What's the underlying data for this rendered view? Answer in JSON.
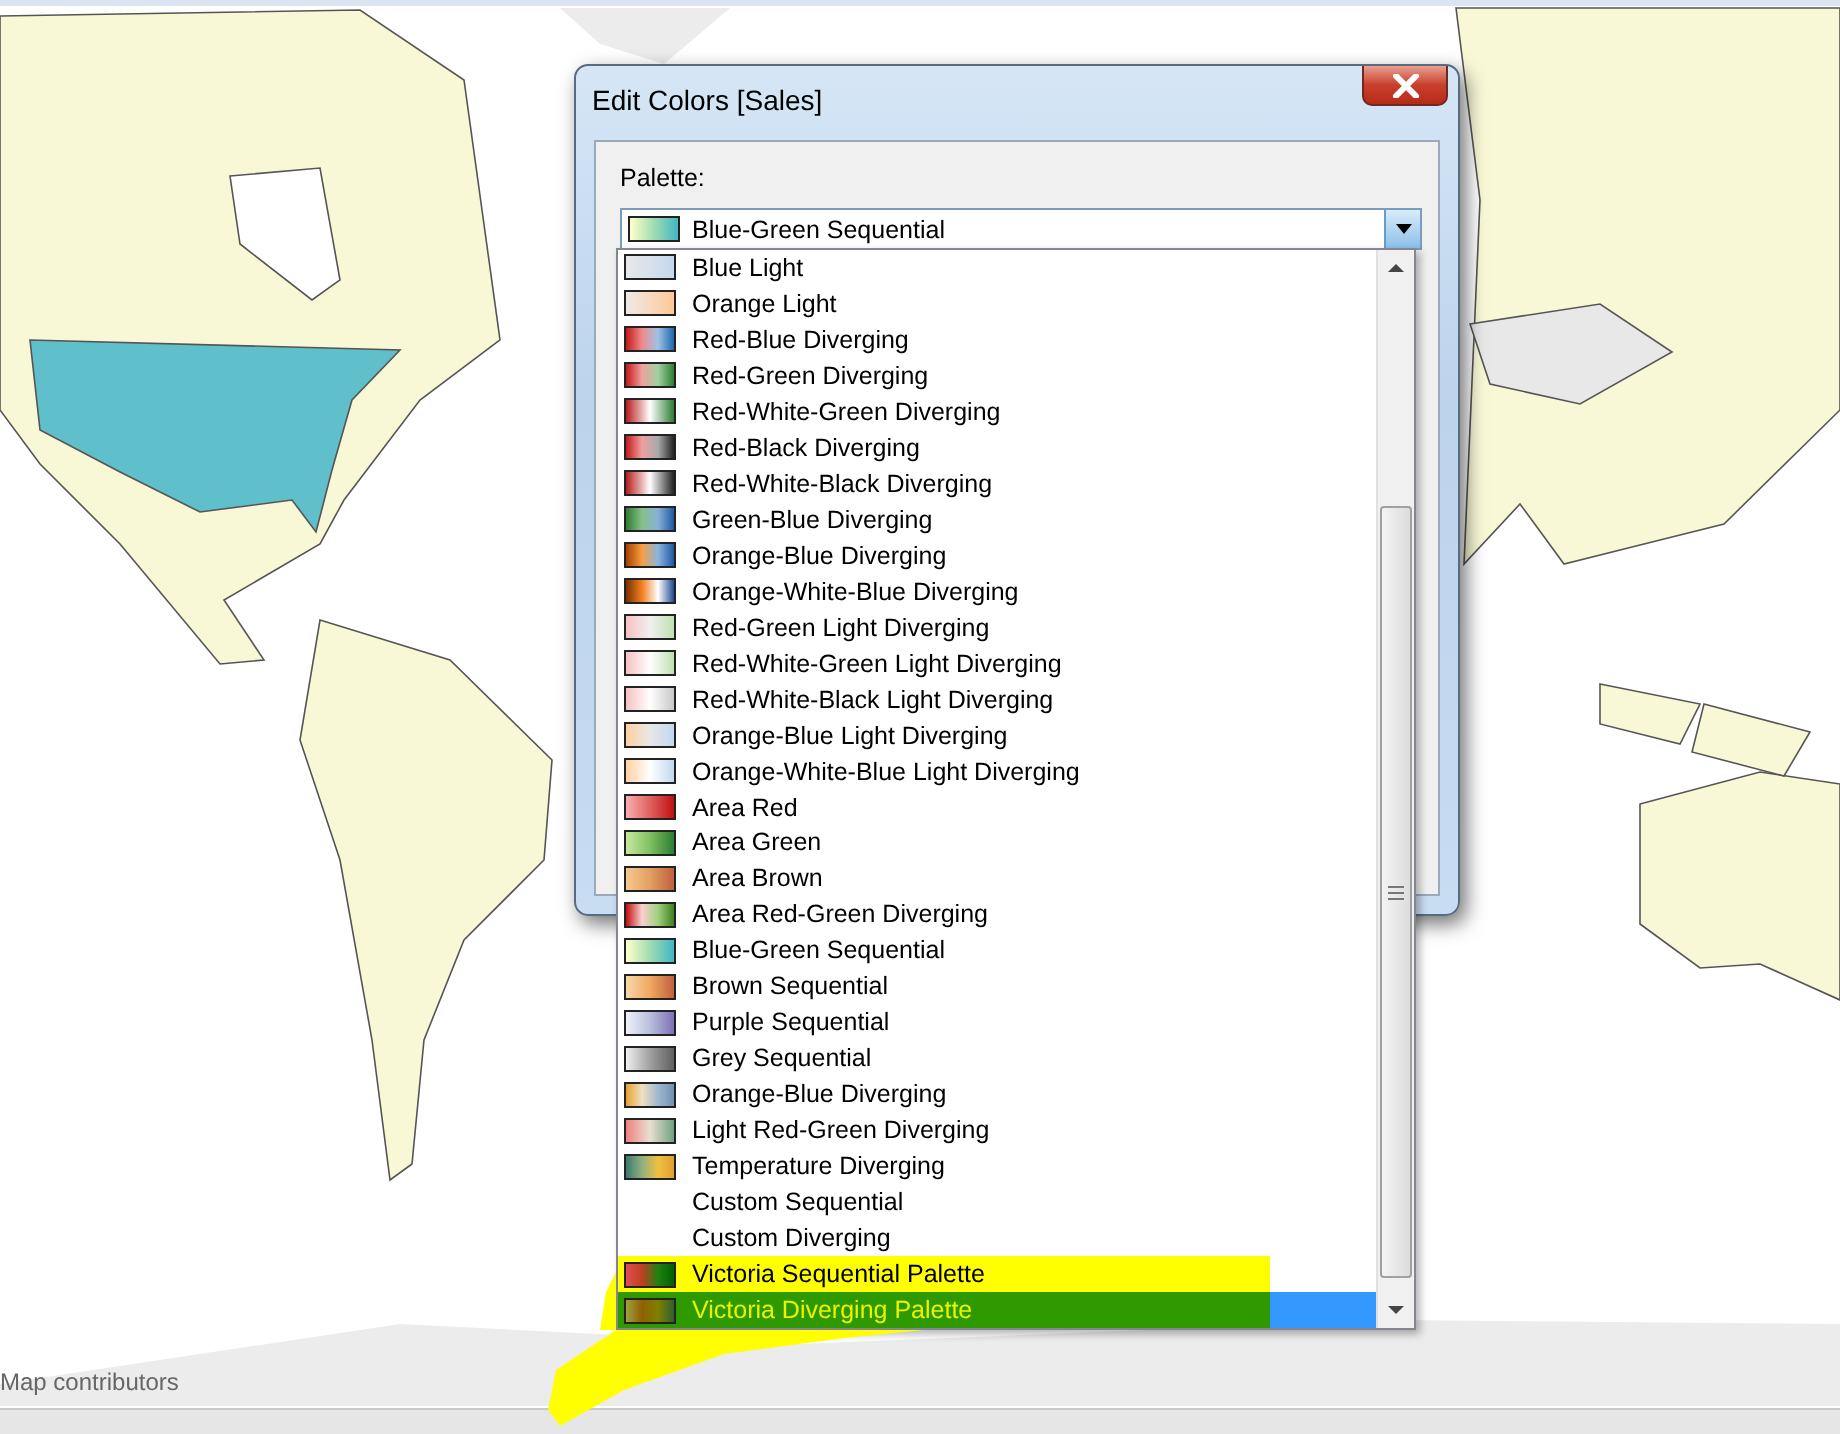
{
  "map": {
    "attribution": "Map contributors"
  },
  "dialog": {
    "title": "Edit Colors [Sales]",
    "palette_label": "Palette:",
    "palette": {
      "value": "Blue-Green Sequential"
    }
  },
  "palette_list": {
    "items": [
      {
        "label": "Blue Light",
        "kind": "swatch",
        "selected": false,
        "highlighted": false
      },
      {
        "label": "Orange Light",
        "kind": "swatch",
        "selected": false,
        "highlighted": false
      },
      {
        "label": "Red-Blue Diverging",
        "kind": "swatch",
        "selected": false,
        "highlighted": false
      },
      {
        "label": "Red-Green Diverging",
        "kind": "swatch",
        "selected": false,
        "highlighted": false
      },
      {
        "label": "Red-White-Green Diverging",
        "kind": "swatch",
        "selected": false,
        "highlighted": false
      },
      {
        "label": "Red-Black Diverging",
        "kind": "swatch",
        "selected": false,
        "highlighted": false
      },
      {
        "label": "Red-White-Black Diverging",
        "kind": "swatch",
        "selected": false,
        "highlighted": false
      },
      {
        "label": "Green-Blue Diverging",
        "kind": "swatch",
        "selected": false,
        "highlighted": false
      },
      {
        "label": "Orange-Blue Diverging",
        "kind": "swatch",
        "selected": false,
        "highlighted": false
      },
      {
        "label": "Orange-White-Blue Diverging",
        "kind": "swatch",
        "selected": false,
        "highlighted": false
      },
      {
        "label": "Red-Green Light Diverging",
        "kind": "swatch",
        "selected": false,
        "highlighted": false
      },
      {
        "label": "Red-White-Green Light Diverging",
        "kind": "swatch",
        "selected": false,
        "highlighted": false
      },
      {
        "label": "Red-White-Black Light Diverging",
        "kind": "swatch",
        "selected": false,
        "highlighted": false
      },
      {
        "label": "Orange-Blue Light Diverging",
        "kind": "swatch",
        "selected": false,
        "highlighted": false
      },
      {
        "label": "Orange-White-Blue Light Diverging",
        "kind": "swatch",
        "selected": false,
        "highlighted": false
      },
      {
        "label": "Area Red",
        "kind": "swatch",
        "selected": false,
        "highlighted": false
      },
      {
        "label": "Area Green",
        "kind": "swatch",
        "selected": false,
        "highlighted": false
      },
      {
        "label": "Area Brown",
        "kind": "swatch",
        "selected": false,
        "highlighted": false
      },
      {
        "label": "Area Red-Green Diverging",
        "kind": "swatch",
        "selected": false,
        "highlighted": false
      },
      {
        "label": "Blue-Green Sequential",
        "kind": "swatch",
        "selected": false,
        "highlighted": false
      },
      {
        "label": "Brown Sequential",
        "kind": "swatch",
        "selected": false,
        "highlighted": false
      },
      {
        "label": "Purple Sequential",
        "kind": "swatch",
        "selected": false,
        "highlighted": false
      },
      {
        "label": "Grey Sequential",
        "kind": "swatch",
        "selected": false,
        "highlighted": false
      },
      {
        "label": "Orange-Blue Diverging",
        "kind": "swatch",
        "selected": false,
        "highlighted": false
      },
      {
        "label": "Light Red-Green Diverging",
        "kind": "swatch",
        "selected": false,
        "highlighted": false
      },
      {
        "label": "Temperature Diverging",
        "kind": "swatch",
        "selected": false,
        "highlighted": false
      },
      {
        "label": "Custom Sequential",
        "kind": "plain",
        "selected": false,
        "highlighted": false
      },
      {
        "label": "Custom Diverging",
        "kind": "plain",
        "selected": false,
        "highlighted": false
      },
      {
        "label": "Victoria Sequential Palette",
        "kind": "swatch",
        "selected": false,
        "highlighted": true
      },
      {
        "label": "Victoria Diverging Palette",
        "kind": "swatch",
        "selected": true,
        "highlighted": true
      }
    ]
  }
}
